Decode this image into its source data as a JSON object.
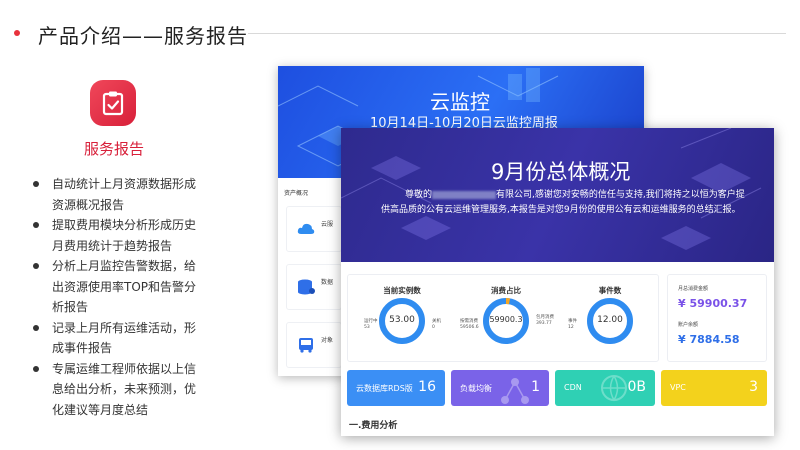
{
  "header": {
    "title": "产品介绍——服务报告"
  },
  "feature": {
    "icon": "clipboard-check-icon",
    "title": "服务报告",
    "bullets": [
      "自动统计上月资源数据形成资源概况报告",
      "提取费用模块分析形成历史月费用统计于趋势报告",
      "分析上月监控告警数据，给出资源使用率TOP和告警分析报告",
      "记录上月所有运维活动，形成事件报告",
      "专属运维工程师依据以上信息给出分析，未来预测，优化建议等月度总结"
    ]
  },
  "back_report": {
    "title": "云监控",
    "subtitle": "10月14日-10月20日云监控周报",
    "section": "资产概况",
    "rows": [
      {
        "icon": "cloud-icon",
        "label": "云服"
      },
      {
        "icon": "database-icon",
        "label": "数据"
      },
      {
        "icon": "bus-icon",
        "label": "对象"
      }
    ]
  },
  "front_report": {
    "title": "9月份总体概况",
    "intro_lead": "尊敬的",
    "intro_rest": "有限公司,感谢您对安畅的信任与支持,我们将持之以恒为客户提供高品质的公有云运维管理服务,本报告是对您9月份的使用公有云和运维服务的总结汇报。",
    "stats": [
      {
        "label": "当前实例数",
        "value": "53.00",
        "side_left_label": "运行中",
        "side_left_value": "53",
        "side_right_label": "关机",
        "side_right_value": "0"
      },
      {
        "label": "消费占比",
        "value": "59900.3",
        "side_left_label": "按需消费",
        "side_left_value": "59506.6",
        "side_right_label": "包月消费",
        "side_right_value": "393.77"
      },
      {
        "label": "事件数",
        "value": "12.00",
        "side_left_label": "事件",
        "side_left_value": "12",
        "side_right_label": "",
        "side_right_value": ""
      }
    ],
    "amounts": {
      "month_label": "月总消费金额",
      "month_value": "¥ 59900.37",
      "balance_label": "账户余额",
      "balance_value": "¥ 7884.58"
    },
    "tiles": [
      {
        "label": "云数据库RDS版",
        "value": "16",
        "color": "#3b8ff5"
      },
      {
        "label": "负载均衡",
        "value": "1",
        "color": "#7a63e8"
      },
      {
        "label": "CDN",
        "value": "0B",
        "color": "#2fd0b4"
      },
      {
        "label": "VPC",
        "value": "3",
        "color": "#f3d21c"
      }
    ],
    "section": "一.费用分析"
  },
  "colors": {
    "accent": "#d8203a",
    "ring": "#2f8cf0",
    "amount": "#7a52e8",
    "balance": "#2f6fe8"
  }
}
